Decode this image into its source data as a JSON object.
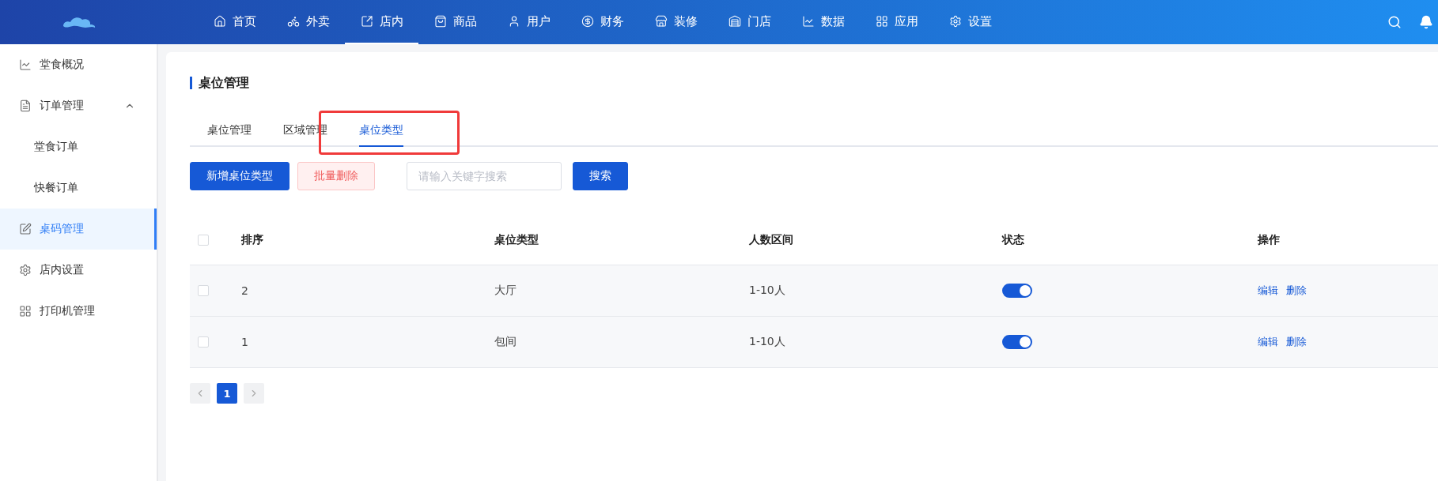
{
  "nav": {
    "items": [
      {
        "label": "首页",
        "selected": false
      },
      {
        "label": "外卖",
        "selected": false
      },
      {
        "label": "店内",
        "selected": true
      },
      {
        "label": "商品",
        "selected": false
      },
      {
        "label": "用户",
        "selected": false
      },
      {
        "label": "财务",
        "selected": false
      },
      {
        "label": "装修",
        "selected": false
      },
      {
        "label": "门店",
        "selected": false
      },
      {
        "label": "数据",
        "selected": false
      },
      {
        "label": "应用",
        "selected": false
      },
      {
        "label": "设置",
        "selected": false
      }
    ]
  },
  "sidebar": {
    "items": [
      {
        "label": "堂食概况",
        "selected": false
      },
      {
        "label": "订单管理",
        "selected": false,
        "expanded": true,
        "children": [
          {
            "label": "堂食订单",
            "selected": false
          },
          {
            "label": "快餐订单",
            "selected": false
          }
        ]
      },
      {
        "label": "桌码管理",
        "selected": true
      },
      {
        "label": "店内设置",
        "selected": false
      },
      {
        "label": "打印机管理",
        "selected": false
      }
    ]
  },
  "page_title": "桌位管理",
  "tabs": [
    {
      "label": "桌位管理",
      "selected": false
    },
    {
      "label": "区域管理",
      "selected": false
    },
    {
      "label": "桌位类型",
      "selected": true
    }
  ],
  "toolbar": {
    "add_button": "新增桌位类型",
    "delete_button": "批量删除",
    "search": {
      "placeholder": "请输入关键字搜索"
    },
    "search_button": "搜索"
  },
  "table": {
    "select_all": {
      "checked": false
    },
    "columns": [
      "排序",
      "桌位类型",
      "人数区间",
      "状态",
      "操作"
    ],
    "rows": [
      {
        "checked": false,
        "order": "2",
        "type": "大厅",
        "range": "1-10人",
        "on": true,
        "actions": [
          "编辑",
          "删除"
        ]
      },
      {
        "checked": false,
        "order": "1",
        "type": "包间",
        "range": "1-10人",
        "on": true,
        "actions": [
          "编辑",
          "删除"
        ]
      }
    ]
  },
  "pagination": {
    "pages": [
      {
        "label": "1",
        "selected": true
      }
    ]
  }
}
